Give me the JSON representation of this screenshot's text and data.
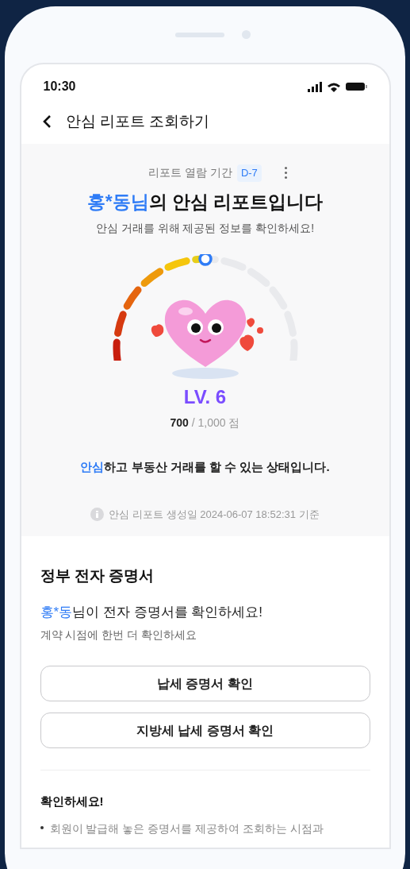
{
  "status_bar": {
    "time": "10:30"
  },
  "header": {
    "title": "안심 리포트 조회하기"
  },
  "report": {
    "period_label": "리포트 열람 기간",
    "period_badge": "D-7",
    "name": "홍*동님",
    "title_rest": "의 안심 리포트입니다",
    "subtitle": "안심 거래를 위해 제공된 정보를 확인하세요!",
    "level_label": "LV. 6",
    "score": "700",
    "score_total": "/ 1,000 점",
    "status_highlight": "안심",
    "status_rest": "하고 부동산 거래를 할 수 있는 상태입니다.",
    "generated": "안심 리포트 생성일 2024-06-07 18:52:31 기준"
  },
  "certificates": {
    "title": "정부 전자 증명서",
    "notice_name": "홍*동",
    "notice_rest": "님이 전자 증명서를 확인하세요!",
    "hint": "계약 시점에 한번 더 확인하세요",
    "buttons": [
      "납세 증명서 확인",
      "지방세 납세 증명서 확인"
    ]
  },
  "checklist": {
    "title": "확인하세요!",
    "items": [
      "회원이 발급해 놓은 증명서를 제공하여 조회하는 시점과"
    ]
  }
}
